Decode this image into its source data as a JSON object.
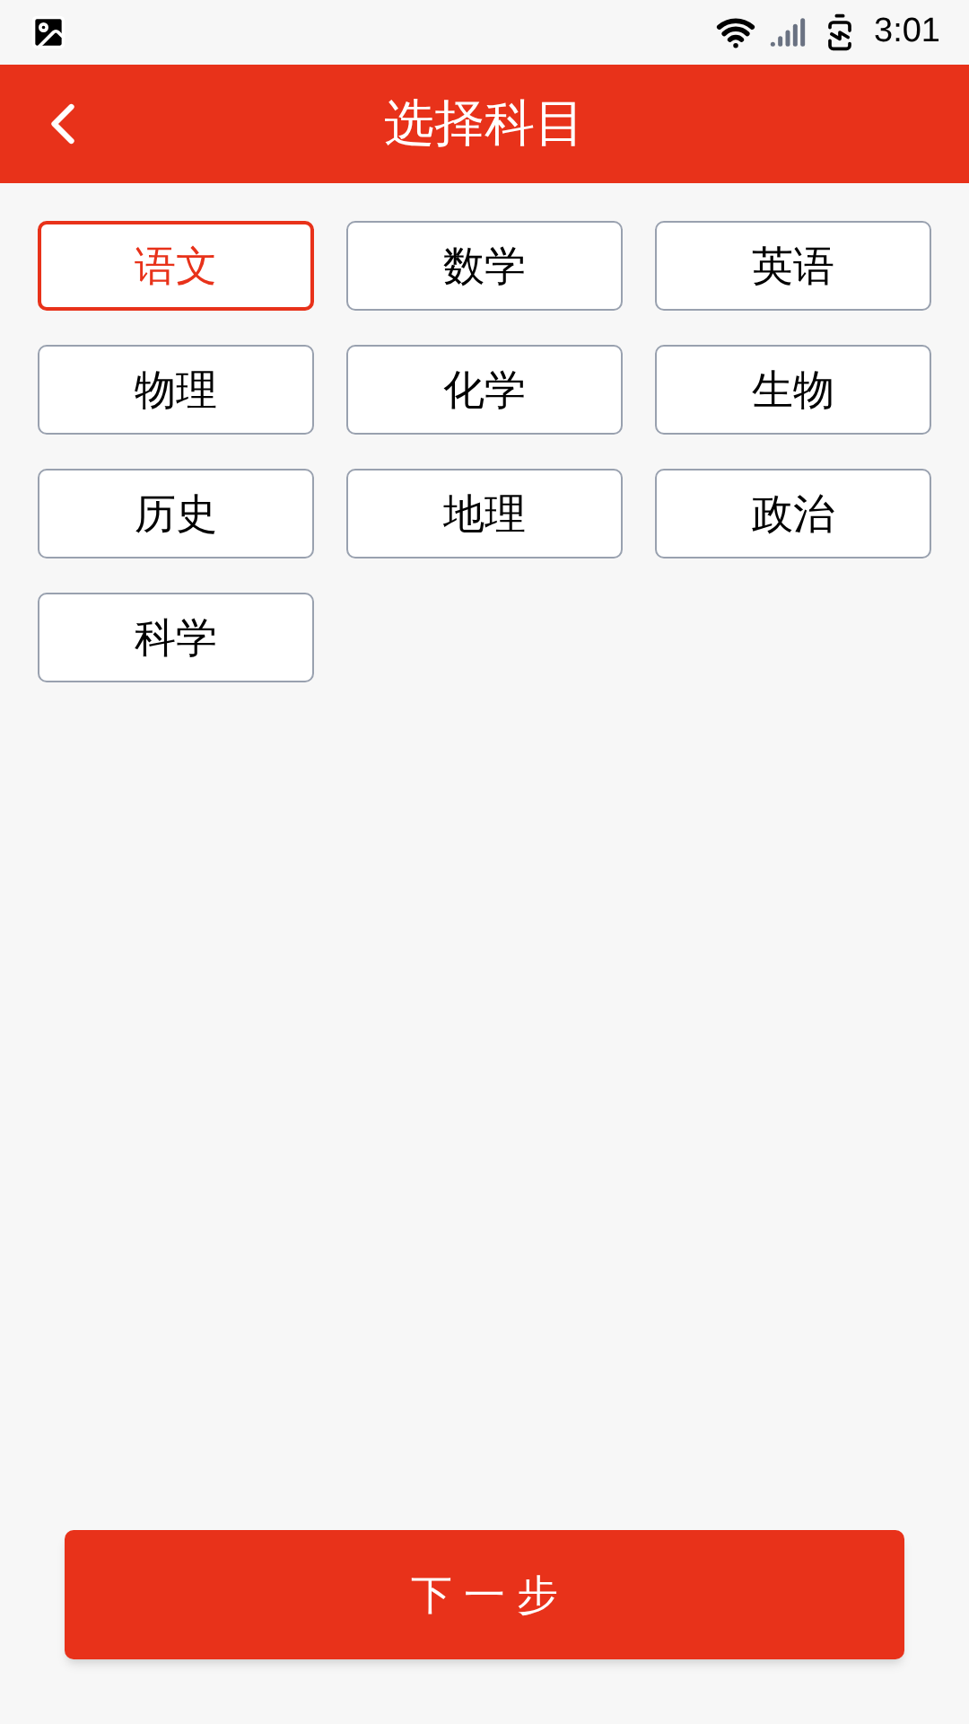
{
  "status_bar": {
    "time": "3:01"
  },
  "header": {
    "title": "选择科目"
  },
  "subjects": [
    {
      "label": "语文",
      "selected": true
    },
    {
      "label": "数学",
      "selected": false
    },
    {
      "label": "英语",
      "selected": false
    },
    {
      "label": "物理",
      "selected": false
    },
    {
      "label": "化学",
      "selected": false
    },
    {
      "label": "生物",
      "selected": false
    },
    {
      "label": "历史",
      "selected": false
    },
    {
      "label": "地理",
      "selected": false
    },
    {
      "label": "政治",
      "selected": false
    },
    {
      "label": "科学",
      "selected": false
    }
  ],
  "next_button": {
    "label": "下 一 步"
  }
}
